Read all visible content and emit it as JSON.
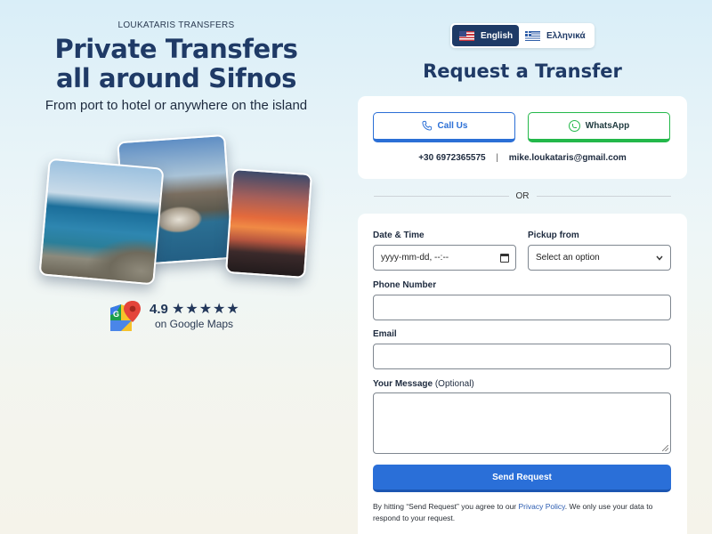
{
  "hero": {
    "brand": "LOUKATARIS TRANSFERS",
    "headline_line1": "Private Transfers",
    "headline_line2": "all around Sifnos",
    "subline": "From port to hotel or anywhere on the island"
  },
  "rating": {
    "score": "4.9",
    "stars": "★★★★★",
    "star_count": 5,
    "label": "on Google Maps",
    "icon": "google-maps-icon"
  },
  "language": {
    "english": "English",
    "greek": "Ελληνικά",
    "selected": "English"
  },
  "request": {
    "title": "Request a Transfer",
    "call_label": "Call Us",
    "whatsapp_label": "WhatsApp",
    "phone": "+30 6972365575",
    "separator": "|",
    "email": "mike.loukataris@gmail.com",
    "or": "OR"
  },
  "form": {
    "datetime_label": "Date & Time",
    "datetime_value": "yyyy-mm-dd, --:--",
    "pickup_label": "Pickup from",
    "pickup_value": "Select an option",
    "phone_label": "Phone Number",
    "email_label": "Email",
    "message_label": "Your Message",
    "message_optional": "(Optional)",
    "submit_label": "Send Request",
    "policy_before": "By hitting “Send Request” you agree to our ",
    "policy_link": "Privacy Policy",
    "policy_after": ". We only use your data to respond to your request."
  },
  "colors": {
    "navy": "#1f3a66",
    "primary_blue": "#2a6fd8",
    "whatsapp_green": "#23b84a"
  }
}
